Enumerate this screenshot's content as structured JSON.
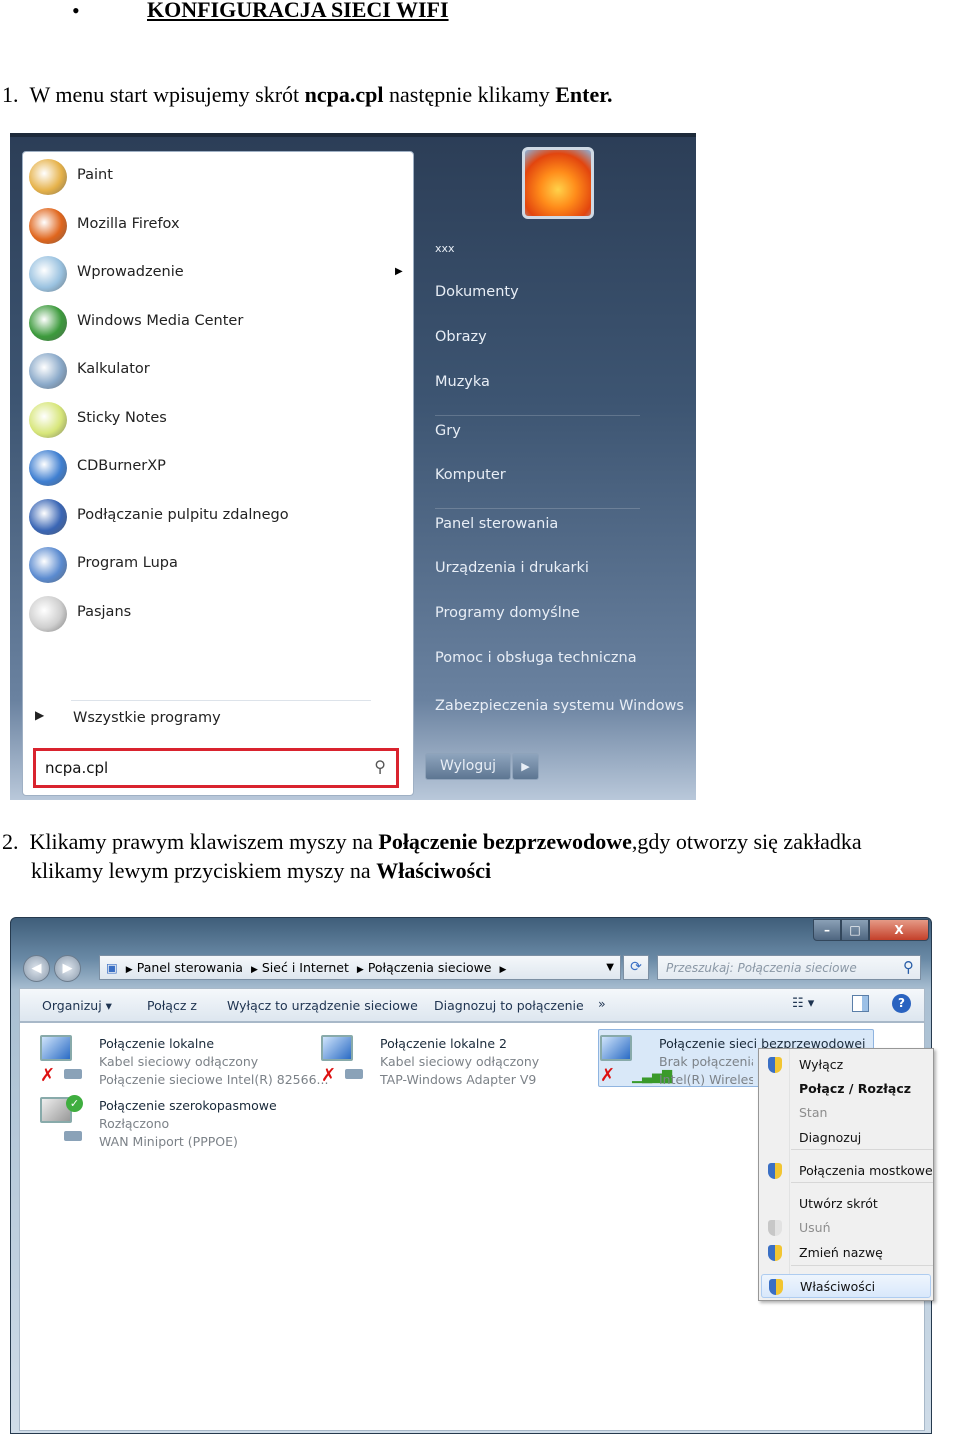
{
  "heading": {
    "bullet": "•",
    "title": "KONFIGURACJA SIECI WIFI"
  },
  "step1": {
    "num": "1.",
    "text_a": "W menu start wpisujemy skrót ",
    "bold_a": "ncpa.cpl",
    "text_b": " następnie klikamy ",
    "bold_b": "Enter."
  },
  "step2": {
    "num": "2.",
    "text_a": "Klikamy prawym klawiszem myszy na ",
    "bold_a": "Połączenie bezprzewodowe",
    "text_b": ",gdy otworzy się zakładka",
    "line2_a": "klikamy lewym przyciskiem myszy na ",
    "bold_b": "Właściwości"
  },
  "start_menu": {
    "programs": [
      {
        "label": "Paint",
        "icon": "paint-icon",
        "color": "#e6b24a"
      },
      {
        "label": "Mozilla Firefox",
        "icon": "firefox-icon",
        "color": "#e0661d"
      },
      {
        "label": "Wprowadzenie",
        "icon": "getting-started-icon",
        "color": "#9ac2e0",
        "submenu": true
      },
      {
        "label": "Windows Media Center",
        "icon": "media-center-icon",
        "color": "#3c9a3c"
      },
      {
        "label": "Kalkulator",
        "icon": "calculator-icon",
        "color": "#8aa9c9"
      },
      {
        "label": "Sticky Notes",
        "icon": "sticky-notes-icon",
        "color": "#d7e67a"
      },
      {
        "label": "CDBurnerXP",
        "icon": "cd-icon",
        "color": "#3f7fd1"
      },
      {
        "label": "Podłączanie pulpitu zdalnego",
        "icon": "remote-desktop-icon",
        "color": "#3a66b5"
      },
      {
        "label": "Program Lupa",
        "icon": "magnifier-icon",
        "color": "#5b8bd0"
      },
      {
        "label": "Pasjans",
        "icon": "solitaire-icon",
        "color": "#cfcfcf"
      }
    ],
    "all_programs": "Wszystkie programy",
    "search_value": "ncpa.cpl",
    "right": [
      "xxx",
      "Dokumenty",
      "Obrazy",
      "Muzyka",
      "Gry",
      "Komputer",
      "Panel sterowania",
      "Urządzenia i drukarki",
      "Programy domyślne",
      "Pomoc i obsługa techniczna",
      "Zabezpieczenia systemu Windows"
    ],
    "logoff": "Wyloguj",
    "highlight_color": "#d9232e"
  },
  "explorer": {
    "breadcrumb": [
      "Panel sterowania",
      "Sieć i Internet",
      "Połączenia sieciowe"
    ],
    "search_placeholder": "Przeszukaj: Połączenia sieciowe",
    "toolbar": [
      "Organizuj ▾",
      "Połącz z",
      "Wyłącz to urządzenie sieciowe",
      "Diagnozuj to połączenie",
      "»"
    ],
    "caption": {
      "minimize": "–",
      "maximize": "□",
      "close": "X"
    },
    "connections": [
      {
        "name": "Połączenie lokalne",
        "status": "Kabel sieciowy odłączony",
        "adapter": "Połączenie sieciowe Intel(R) 82566..."
      },
      {
        "name": "Połączenie lokalne 2",
        "status": "Kabel sieciowy odłączony",
        "adapter": "TAP-Windows Adapter V9"
      },
      {
        "name": "Połączenie sieci bezprzewodowej",
        "status": "Brak połączenia",
        "adapter": "Intel(R) Wireless"
      },
      {
        "name": "Połączenie szerokopasmowe",
        "status": "Rozłączono",
        "adapter": "WAN Miniport (PPPOE)"
      }
    ],
    "context_menu": [
      {
        "label": "Wyłącz",
        "shield": true
      },
      {
        "label": "Połącz / Rozłącz",
        "bold": true
      },
      {
        "label": "Stan",
        "disabled": true
      },
      {
        "label": "Diagnozuj"
      },
      {
        "label": "Połączenia mostkowe",
        "shield": true
      },
      {
        "label": "Utwórz skrót"
      },
      {
        "label": "Usuń",
        "disabled": true,
        "shield": true
      },
      {
        "label": "Zmień nazwę",
        "shield": true
      },
      {
        "label": "Właściwości",
        "shield": true,
        "highlighted": true
      }
    ]
  }
}
